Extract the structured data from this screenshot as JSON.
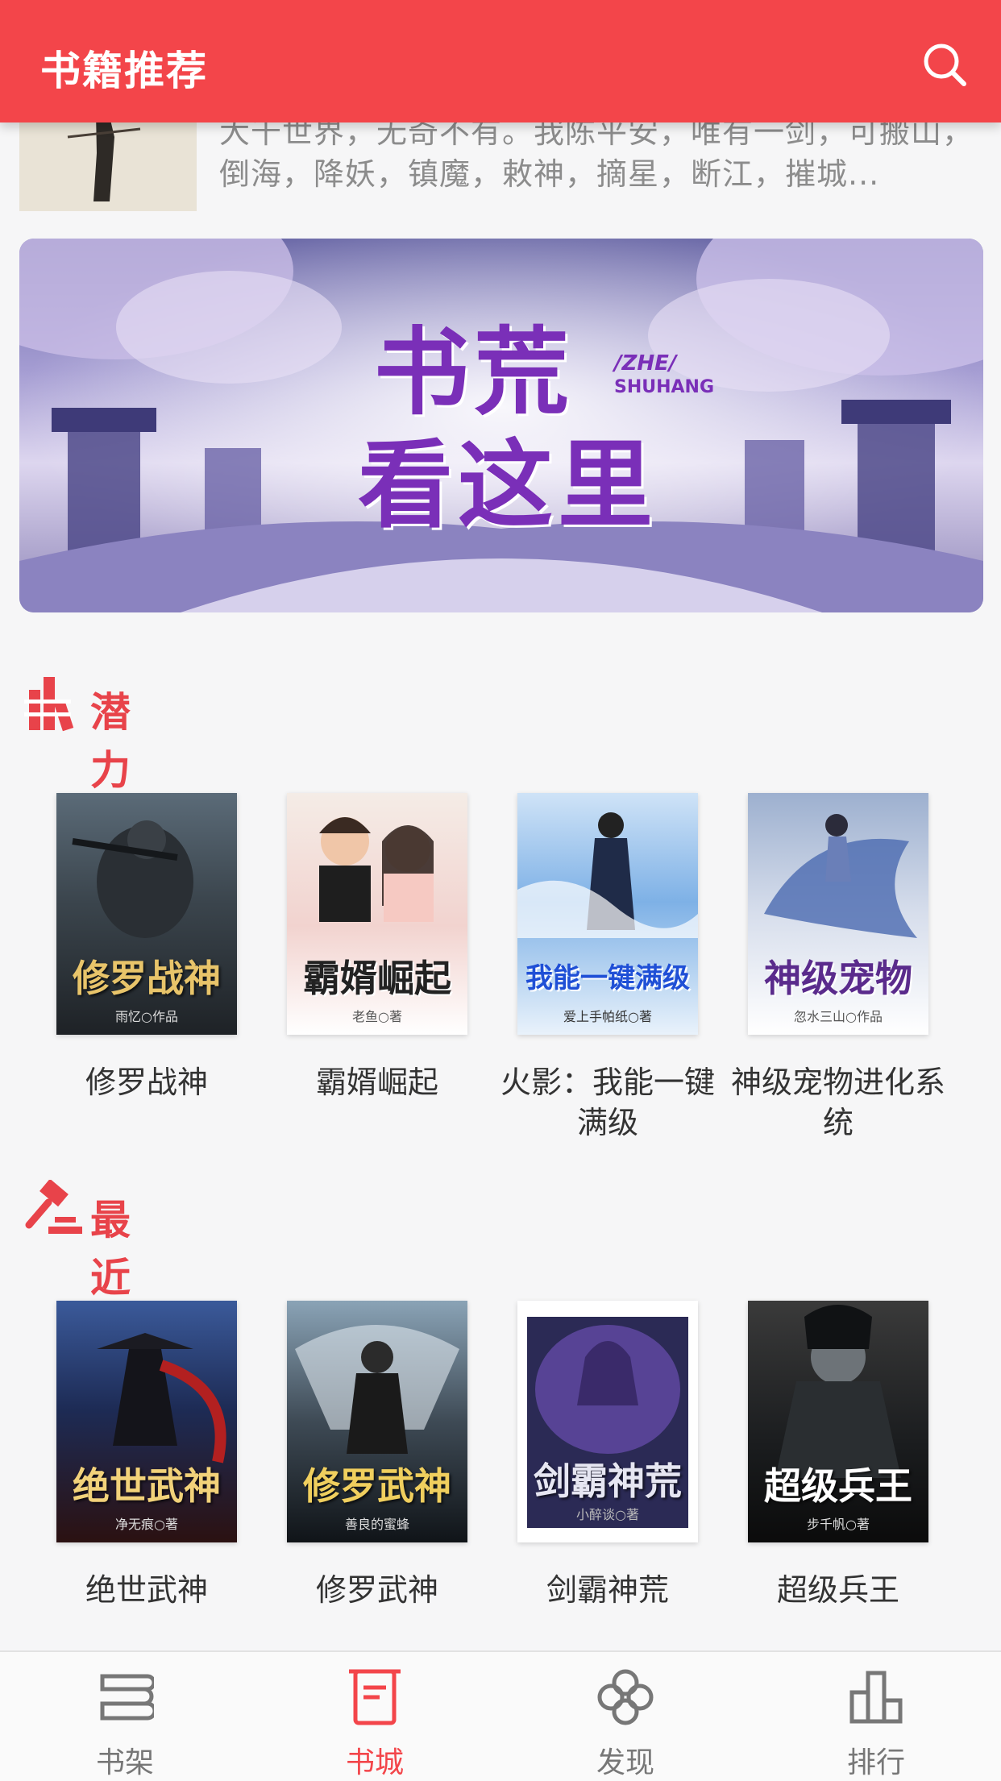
{
  "header": {
    "title": "书籍推荐"
  },
  "previous_item": {
    "description": "大千世界，无奇不有。我陈平安，唯有一剑，可搬山，倒海，降妖，镇魔，敕神，摘星，断江，摧城..."
  },
  "banner": {
    "headline_top": "书荒",
    "headline_bottom": "看这里",
    "tag_line1": "/ZHE/",
    "tag_line2": "SHUHANG"
  },
  "sections": [
    {
      "title": "潜力新书",
      "icon": "bar-chart-icon",
      "books": [
        {
          "name": "修罗战神",
          "cover_title": "修罗战神",
          "cover_author": "雨忆○作品",
          "accent": "#c9a24a"
        },
        {
          "name": "霸婿崛起",
          "cover_title": "霸婿崛起",
          "cover_author": "老鱼○著",
          "accent": "#2a2a2a"
        },
        {
          "name": "火影：我能一键满级",
          "cover_title": "我能一键满级",
          "cover_author": "爱上手帕纸○著",
          "accent": "#1f4fd6"
        },
        {
          "name": "神级宠物进化系统",
          "cover_title": "神级宠物",
          "cover_author": "忽水三山○作品",
          "accent": "#5a2b8c"
        }
      ]
    },
    {
      "title": "最近更新",
      "icon": "gavel-icon",
      "books": [
        {
          "name": "绝世武神",
          "cover_title": "绝世武神",
          "cover_author": "净无痕○著",
          "accent": "#d8b25a"
        },
        {
          "name": "修罗武神",
          "cover_title": "修罗武神",
          "cover_author": "善良的蜜蜂",
          "accent": "#e0c060"
        },
        {
          "name": "剑霸神荒",
          "cover_title": "剑霸神荒",
          "cover_author": "小醉谈○著",
          "accent": "#c8c8d8"
        },
        {
          "name": "超级兵王",
          "cover_title": "超级兵王",
          "cover_author": "步千帆○著",
          "accent": "#ffffff"
        }
      ]
    }
  ],
  "tabbar": {
    "items": [
      {
        "label": "书架",
        "icon": "bookshelf-icon"
      },
      {
        "label": "书城",
        "icon": "book-store-icon"
      },
      {
        "label": "发现",
        "icon": "discover-icon"
      },
      {
        "label": "排行",
        "icon": "ranking-icon"
      }
    ],
    "active_index": 1
  },
  "colors": {
    "brand": "#f3454a",
    "section_title": "#e8434a",
    "text": "#333333",
    "muted": "#8c8c8c"
  }
}
